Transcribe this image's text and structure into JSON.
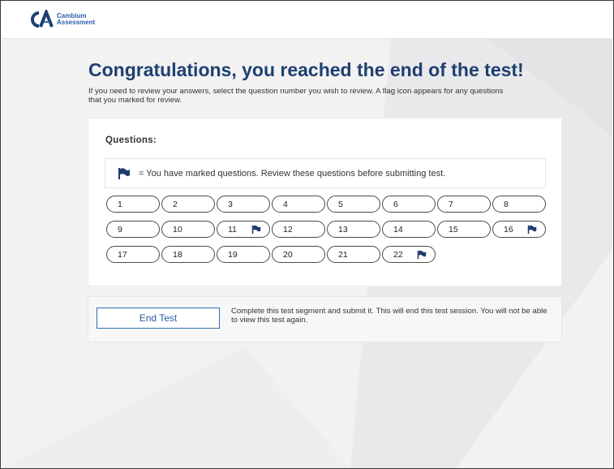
{
  "brand": {
    "logo_mark": "CA",
    "name_line1": "Cambium",
    "name_line2": "Assessment",
    "accent_color": "#1f3f70"
  },
  "title": "Congratulations, you reached the end of the test!",
  "subtitle": "If you need to review your answers, select the question number you wish to review. A flag icon appears for any questions that you marked for review.",
  "questions_panel": {
    "heading": "Questions:",
    "legend_text": "= You have marked questions. Review these questions before submitting test.",
    "items": [
      {
        "label": "1",
        "flagged": false
      },
      {
        "label": "2",
        "flagged": false
      },
      {
        "label": "3",
        "flagged": false
      },
      {
        "label": "4",
        "flagged": false
      },
      {
        "label": "5",
        "flagged": false
      },
      {
        "label": "6",
        "flagged": false
      },
      {
        "label": "7",
        "flagged": false
      },
      {
        "label": "8",
        "flagged": false
      },
      {
        "label": "9",
        "flagged": false
      },
      {
        "label": "10",
        "flagged": false
      },
      {
        "label": "11",
        "flagged": true
      },
      {
        "label": "12",
        "flagged": false
      },
      {
        "label": "13",
        "flagged": false
      },
      {
        "label": "14",
        "flagged": false
      },
      {
        "label": "15",
        "flagged": false
      },
      {
        "label": "16",
        "flagged": true
      },
      {
        "label": "17",
        "flagged": false
      },
      {
        "label": "18",
        "flagged": false
      },
      {
        "label": "19",
        "flagged": false
      },
      {
        "label": "20",
        "flagged": false
      },
      {
        "label": "21",
        "flagged": false
      },
      {
        "label": "22",
        "flagged": true
      }
    ]
  },
  "end_panel": {
    "button_label": "End Test",
    "description": "Complete this test segment and submit it. This will end this test session. You will not be able to view this test again."
  },
  "icons": {
    "flag": "flag-icon",
    "flag_color": "#1f3a6e"
  }
}
